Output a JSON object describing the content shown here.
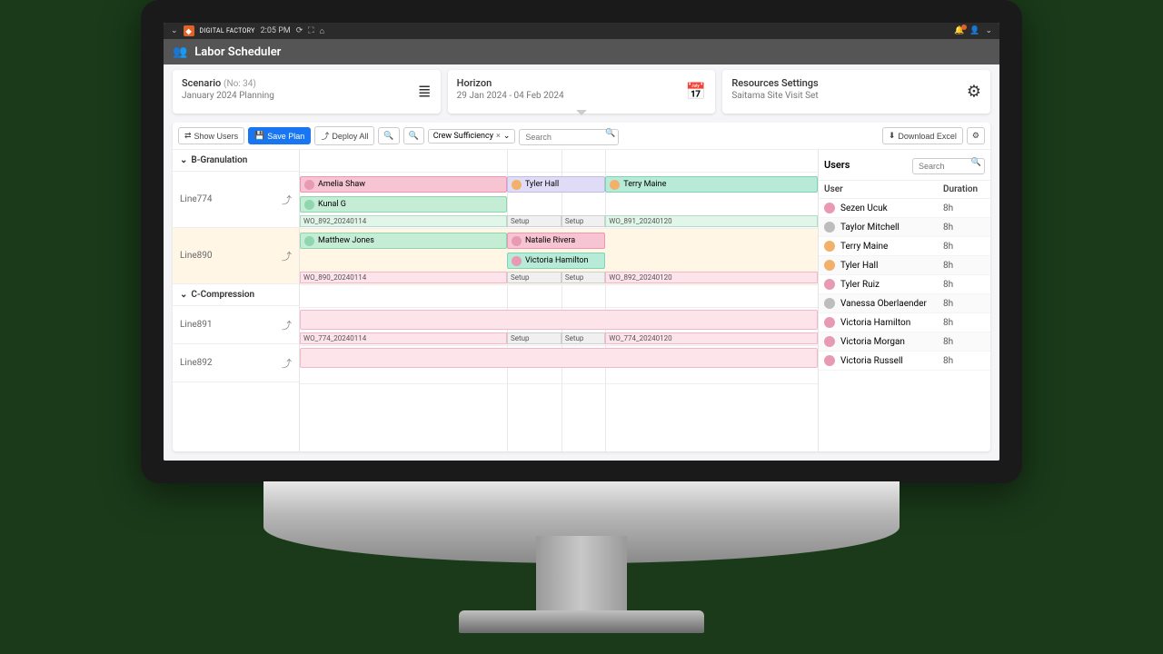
{
  "topbar": {
    "brand": "DIGITAL FACTORY",
    "time": "2:05 PM",
    "chevron": "⌄",
    "refresh_icon": "⟳",
    "fullscreen_icon": "⛶",
    "home_icon": "⌂",
    "bell_icon": "🔔",
    "user_icon": "👤"
  },
  "header": {
    "icon": "👥",
    "title": "Labor Scheduler"
  },
  "cards": {
    "scenario": {
      "title": "Scenario",
      "no": "(No: 34)",
      "sub": "January 2024 Planning",
      "action": "≣"
    },
    "horizon": {
      "title": "Horizon",
      "sub": "29 Jan 2024 - 04 Feb 2024",
      "action": "📅"
    },
    "resources": {
      "title": "Resources Settings",
      "sub": "Saitama Site Visit Set",
      "action": "⚙"
    }
  },
  "toolbar": {
    "show_users": "Show Users",
    "save_plan": "Save Plan",
    "deploy_all": "Deploy All",
    "zoom_in": "🔍+",
    "zoom_out": "🔍−",
    "filter_chip": "Crew Sufficiency",
    "search_placeholder": "Search",
    "download": "Download Excel",
    "settings": "⚙"
  },
  "gantt": {
    "groups": [
      {
        "name": "B-Granulation"
      },
      {
        "name": "C-Compression"
      }
    ],
    "lines": [
      "Line774",
      "Line890",
      "Line891",
      "Line892"
    ],
    "tasks": {
      "amelia": "Amelia Shaw",
      "kunal": "Kunal G",
      "tyler": "Tyler Hall",
      "terry": "Terry Maine",
      "matthew": "Matthew Jones",
      "natalie": "Natalie Rivera",
      "victoria": "Victoria Hamilton"
    },
    "wo": {
      "w892_114": "WO_892_20240114",
      "w891_120": "WO_891_20240120",
      "w890_114": "WO_890_20240114",
      "w892_120": "WO_892_20240120",
      "w774_114": "WO_774_20240114",
      "w774_120": "WO_774_20240120",
      "setup": "Setup"
    }
  },
  "users_panel": {
    "title": "Users",
    "search_placeholder": "Search",
    "col_user": "User",
    "col_duration": "Duration",
    "rows": [
      {
        "name": "Sezen Ucuk",
        "dur": "8h",
        "color": "#e89ab3"
      },
      {
        "name": "Taylor Mitchell",
        "dur": "8h",
        "color": "#bdbdbd"
      },
      {
        "name": "Terry Maine",
        "dur": "8h",
        "color": "#f2b06a"
      },
      {
        "name": "Tyler Hall",
        "dur": "8h",
        "color": "#f2b06a"
      },
      {
        "name": "Tyler Ruiz",
        "dur": "8h",
        "color": "#e89ab3"
      },
      {
        "name": "Vanessa Oberlaender",
        "dur": "8h",
        "color": "#bdbdbd"
      },
      {
        "name": "Victoria Hamilton",
        "dur": "8h",
        "color": "#e89ab3"
      },
      {
        "name": "Victoria Morgan",
        "dur": "8h",
        "color": "#e89ab3"
      },
      {
        "name": "Victoria Russell",
        "dur": "8h",
        "color": "#e89ab3"
      }
    ]
  }
}
